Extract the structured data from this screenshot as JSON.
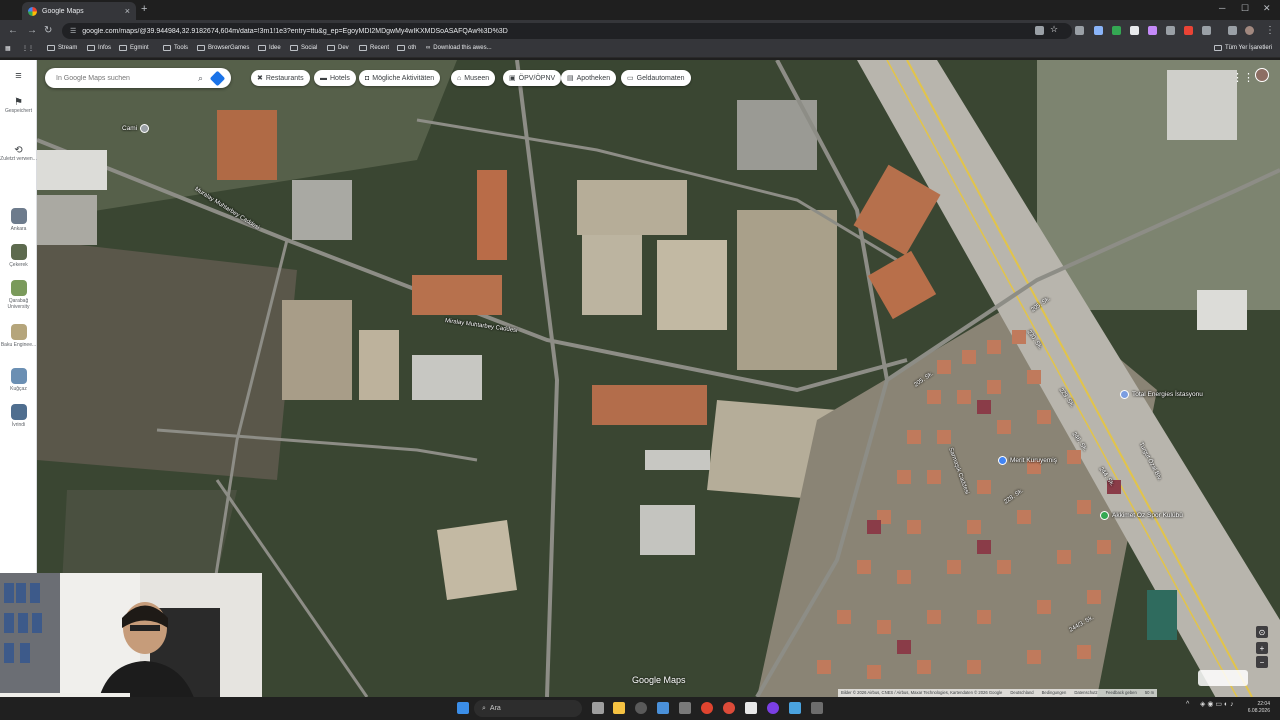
{
  "browser": {
    "tab_title": "Google Maps",
    "tab_close": "×",
    "new_tab": "+",
    "url": "google.com/maps/@39.944984,32.9182674,604m/data=!3m1!1e3?entry=ttu&g_ep=EgoyMDI2MDgwMy4wIKXMDSoASAFQAw%3D%3D",
    "bookmarks": [
      "Stream",
      "Infos",
      "Egmint",
      "Tools",
      "BrowserGames",
      "Idee",
      "Social",
      "Dev",
      "Recent",
      "oth",
      "Download this awes..."
    ],
    "all_bookmarks": "Tüm Yer İşaretleri"
  },
  "maps": {
    "search_placeholder": "In Google Maps suchen",
    "chips": [
      {
        "icon": "fork-knife-icon",
        "label": "Restaurants"
      },
      {
        "icon": "bed-icon",
        "label": "Hotels"
      },
      {
        "icon": "camera-icon",
        "label": "Mögliche Aktivitäten"
      },
      {
        "icon": "museum-icon",
        "label": "Museen"
      },
      {
        "icon": "transit-icon",
        "label": "ÖPV/ÖPNV"
      },
      {
        "icon": "pharmacy-icon",
        "label": "Apotheken"
      },
      {
        "icon": "atm-icon",
        "label": "Geldautomaten"
      }
    ],
    "rail": {
      "menu": "≡",
      "saved": "Gespeichert",
      "recent": "Zuletzt verwen...",
      "places": [
        "Ankara",
        "Çekerek",
        "Qarabağ University",
        "Baku Enginee...",
        "Kuğçaz",
        "İvrindi"
      ]
    },
    "streets": [
      {
        "name": "Muralay Muhtarbey Caddesi",
        "angle": 32
      },
      {
        "name": "Miralay Muhtarbey Caddesi",
        "angle": 8
      },
      {
        "name": "205. Sk.",
        "angle": -35
      },
      {
        "name": "205. Sk.",
        "angle": -35
      },
      {
        "name": "230. Sk.",
        "angle": 55
      },
      {
        "name": "229. Sk.",
        "angle": 55
      },
      {
        "name": "228. Sk.",
        "angle": -35
      },
      {
        "name": "246. Sk.",
        "angle": 55
      },
      {
        "name": "244. Sk.",
        "angle": 55
      },
      {
        "name": "Sarmaşık Caddesi",
        "angle": 70
      },
      {
        "name": "Turgut Özal Blv.",
        "angle": 62
      },
      {
        "name": "244/3. Sk.",
        "angle": -30
      }
    ],
    "pois": [
      {
        "label": "Total Energies İstasyonu",
        "color": "#7b9de0"
      },
      {
        "label": "Merit Kuruyemiş",
        "color": "#4285f4"
      },
      {
        "label": "Akkimet Oz Spor Kulübü",
        "color": "#34a853"
      },
      {
        "label": "Cami",
        "color": "#9aa0a6"
      }
    ],
    "logo": "Google Maps",
    "attribution": [
      "Bilder © 2026 Airbus, CNES / Airbus, Maxar Technologies, Kartendaten © 2026 Google",
      "Deutschland",
      "Bedingungen",
      "Datenschutz",
      "Feedback geben",
      "50 m"
    ],
    "controls": {
      "locate": "⊙",
      "zoom_in": "+",
      "zoom_out": "−"
    }
  },
  "taskbar": {
    "search": "Ara",
    "time": "22:04",
    "date": "6.08.2026"
  },
  "colors": {
    "chrome_dark": "#1f1f1f",
    "chrome_mid": "#35363a",
    "accent_blue": "#1a73e8"
  }
}
